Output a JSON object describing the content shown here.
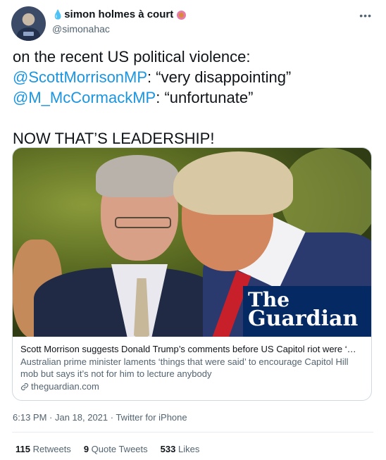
{
  "author": {
    "display_name": "simon holmes à court",
    "handle": "@simonahac",
    "prefix_emoji_icon": "droplet-icon",
    "suffix_emoji_icon": "doughnut-icon"
  },
  "more_menu_icon": "more-icon",
  "tweet": {
    "line1": "on the recent US political violence:",
    "mention1": "@ScottMorrisonMP",
    "quote1": ": “very disappointing”",
    "mention2": "@M_McCormackMP",
    "quote2": ": “unfortunate”",
    "line4": "NOW THAT’S LEADERSHIP!"
  },
  "card": {
    "logo_line1": "The",
    "logo_line2": "Guardian",
    "title": "Scott Morrison suggests Donald Trump’s comments before US Capitol riot were ‘…",
    "description": "Australian prime minister laments ‘things that were said’ to encourage Capitol Hill mob but says it’s not for him to lecture anybody",
    "domain": "theguardian.com",
    "link_icon": "link-icon"
  },
  "meta": {
    "timestamp": "6:13 PM · Jan 18, 2021 · Twitter for iPhone"
  },
  "stats": {
    "retweets_count": "115",
    "retweets_label": "Retweets",
    "quotes_count": "9",
    "quotes_label": "Quote Tweets",
    "likes_count": "533",
    "likes_label": "Likes"
  },
  "colors": {
    "mention": "#1b95e0",
    "guardian_blue": "#052962",
    "secondary_text": "#536471"
  }
}
